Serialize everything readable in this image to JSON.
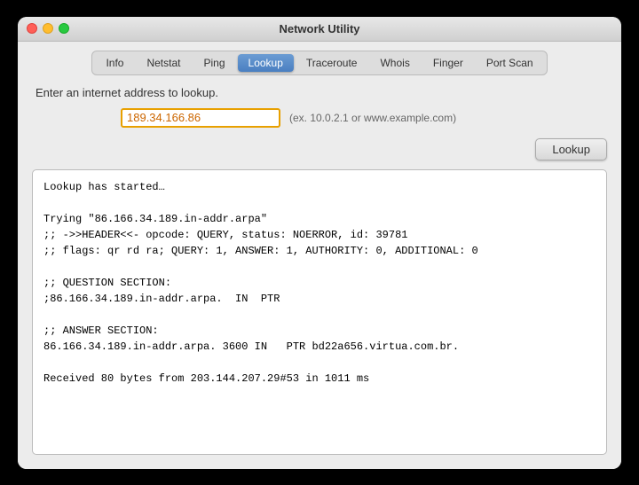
{
  "window": {
    "title": "Network Utility"
  },
  "tabs": [
    {
      "id": "info",
      "label": "Info",
      "active": false
    },
    {
      "id": "netstat",
      "label": "Netstat",
      "active": false
    },
    {
      "id": "ping",
      "label": "Ping",
      "active": false
    },
    {
      "id": "lookup",
      "label": "Lookup",
      "active": true
    },
    {
      "id": "traceroute",
      "label": "Traceroute",
      "active": false
    },
    {
      "id": "whois",
      "label": "Whois",
      "active": false
    },
    {
      "id": "finger",
      "label": "Finger",
      "active": false
    },
    {
      "id": "portscan",
      "label": "Port Scan",
      "active": false
    }
  ],
  "prompt": "Enter an internet address to lookup.",
  "input": {
    "value": "189.34.166.86",
    "placeholder": "189.34.166.86"
  },
  "example": "(ex. 10.0.2.1 or www.example.com)",
  "buttons": {
    "lookup": "Lookup"
  },
  "output": "Lookup has started…\n\nTrying \"86.166.34.189.in-addr.arpa\"\n;; ->>HEADER<<- opcode: QUERY, status: NOERROR, id: 39781\n;; flags: qr rd ra; QUERY: 1, ANSWER: 1, AUTHORITY: 0, ADDITIONAL: 0\n\n;; QUESTION SECTION:\n;86.166.34.189.in-addr.arpa.  IN  PTR\n\n;; ANSWER SECTION:\n86.166.34.189.in-addr.arpa. 3600 IN   PTR bd22a656.virtua.com.br.\n\nReceived 80 bytes from 203.144.207.29#53 in 1011 ms"
}
